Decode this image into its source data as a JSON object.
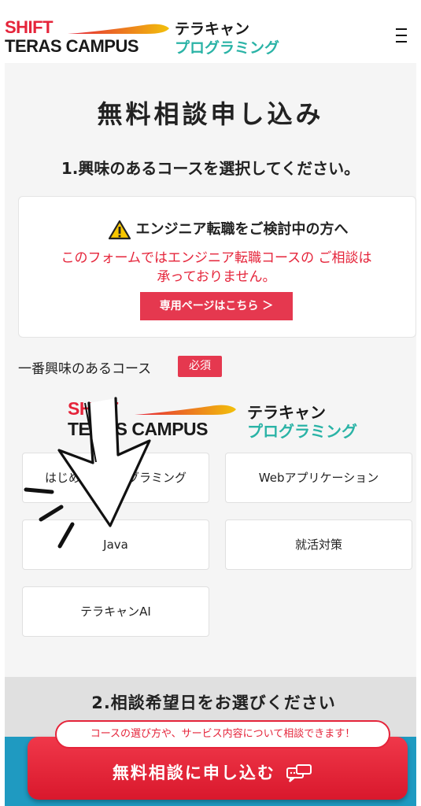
{
  "header": {
    "logo": {
      "shift": "SHIFT",
      "teras": "TERAS CAMPUS",
      "tera_jp": "テラキャン",
      "prog_jp": "プログラミング"
    }
  },
  "form": {
    "title": "無料相談申し込み",
    "step1": "1.興味のあるコースを選択してください。",
    "notice": {
      "heading": "エンジニア転職をご検討中の方へ",
      "message_line1": "このフォームではエンジニア転職コースの ご相談は",
      "message_line2": "承っておりません。",
      "button": "専用ページはこちら ＞"
    },
    "course_label": "一番興味のあるコース",
    "required_badge": "必須",
    "overlay_logo": {
      "shift": "SHIFT",
      "teras": "TERAS CAMPUS",
      "tera_jp": "テラキャン",
      "prog_jp": "プログラミング"
    },
    "courses": [
      "はじめてのプログラミング",
      "Webアプリケーション",
      "Java",
      "就活対策",
      "テラキャンAI"
    ],
    "step2": "2.相談希望日をお選びください"
  },
  "cta": {
    "bubble": "コースの選び方や、サービス内容について相談できます！",
    "button": "無料相談に申し込む"
  },
  "colors": {
    "brand_red": "#e5243a",
    "teal": "#2ab3a6",
    "blue": "#1f9ac1"
  },
  "icons": [
    "warning-icon",
    "chat-icon",
    "menu-icon",
    "arrow-annotation"
  ]
}
